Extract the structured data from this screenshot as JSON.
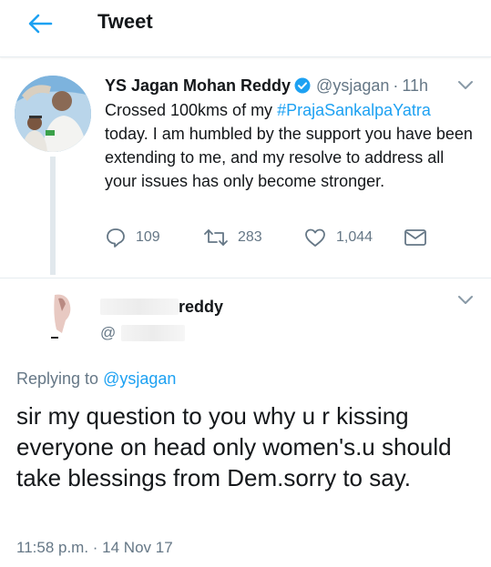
{
  "header": {
    "title": "Tweet",
    "back_icon": "arrow-left-icon"
  },
  "colors": {
    "accent": "#1da1f2",
    "text": "#14171a",
    "muted": "#657786",
    "border": "#e6ecf0"
  },
  "tweet": {
    "author_name": "YS Jagan Mohan Reddy",
    "verified_icon": "verified-badge-icon",
    "handle": "@ysjagan",
    "separator": "·",
    "time": "11h",
    "text_before": "Crossed 100kms of my ",
    "hashtag": "#PrajaSankalpaYatra",
    "text_after": " today. I am humbled by the support you have been extending to me, and my resolve to address all your issues has only become stronger.",
    "reply_count": "109",
    "retweet_count": "283",
    "like_count": "1,044"
  },
  "reply": {
    "name_suffix": "reddy",
    "handle_prefix": "@",
    "replying_label": "Replying to ",
    "replying_to": "@ysjagan",
    "text": "sir my question to you why u r kissing everyone on head only women's.u should take blessings from Dem.sorry to say.",
    "timestamp": "11:58 p.m. · 14 Nov 17"
  }
}
